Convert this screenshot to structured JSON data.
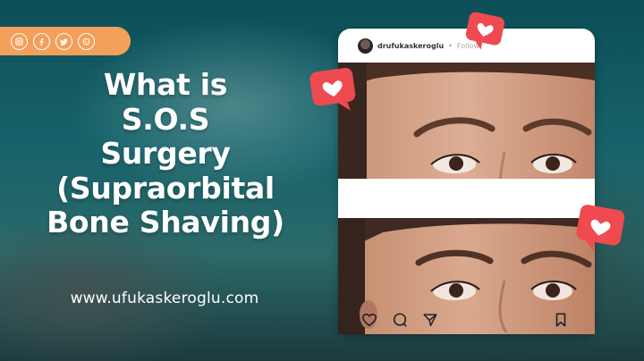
{
  "social": {
    "icons": [
      "instagram-icon",
      "facebook-icon",
      "twitter-icon",
      "whatsapp-icon"
    ],
    "pill_color": "#f3a05a"
  },
  "headline": {
    "line1": "What is",
    "line2": "S.O.S",
    "line3": "Surgery",
    "line4": "(Supraorbital",
    "line5": "Bone Shaving)"
  },
  "website": "www.ufukaskeroglu.com",
  "post": {
    "handle": "drufukaskeroglu",
    "separator": "•",
    "follow_label": "Follow",
    "action_icons": [
      "heart-icon",
      "comment-icon",
      "share-icon",
      "bookmark-icon"
    ]
  },
  "colors": {
    "accent_orange": "#f3a05a",
    "heart_bubble_red": "#ef4a50",
    "text_white": "#ffffff"
  }
}
